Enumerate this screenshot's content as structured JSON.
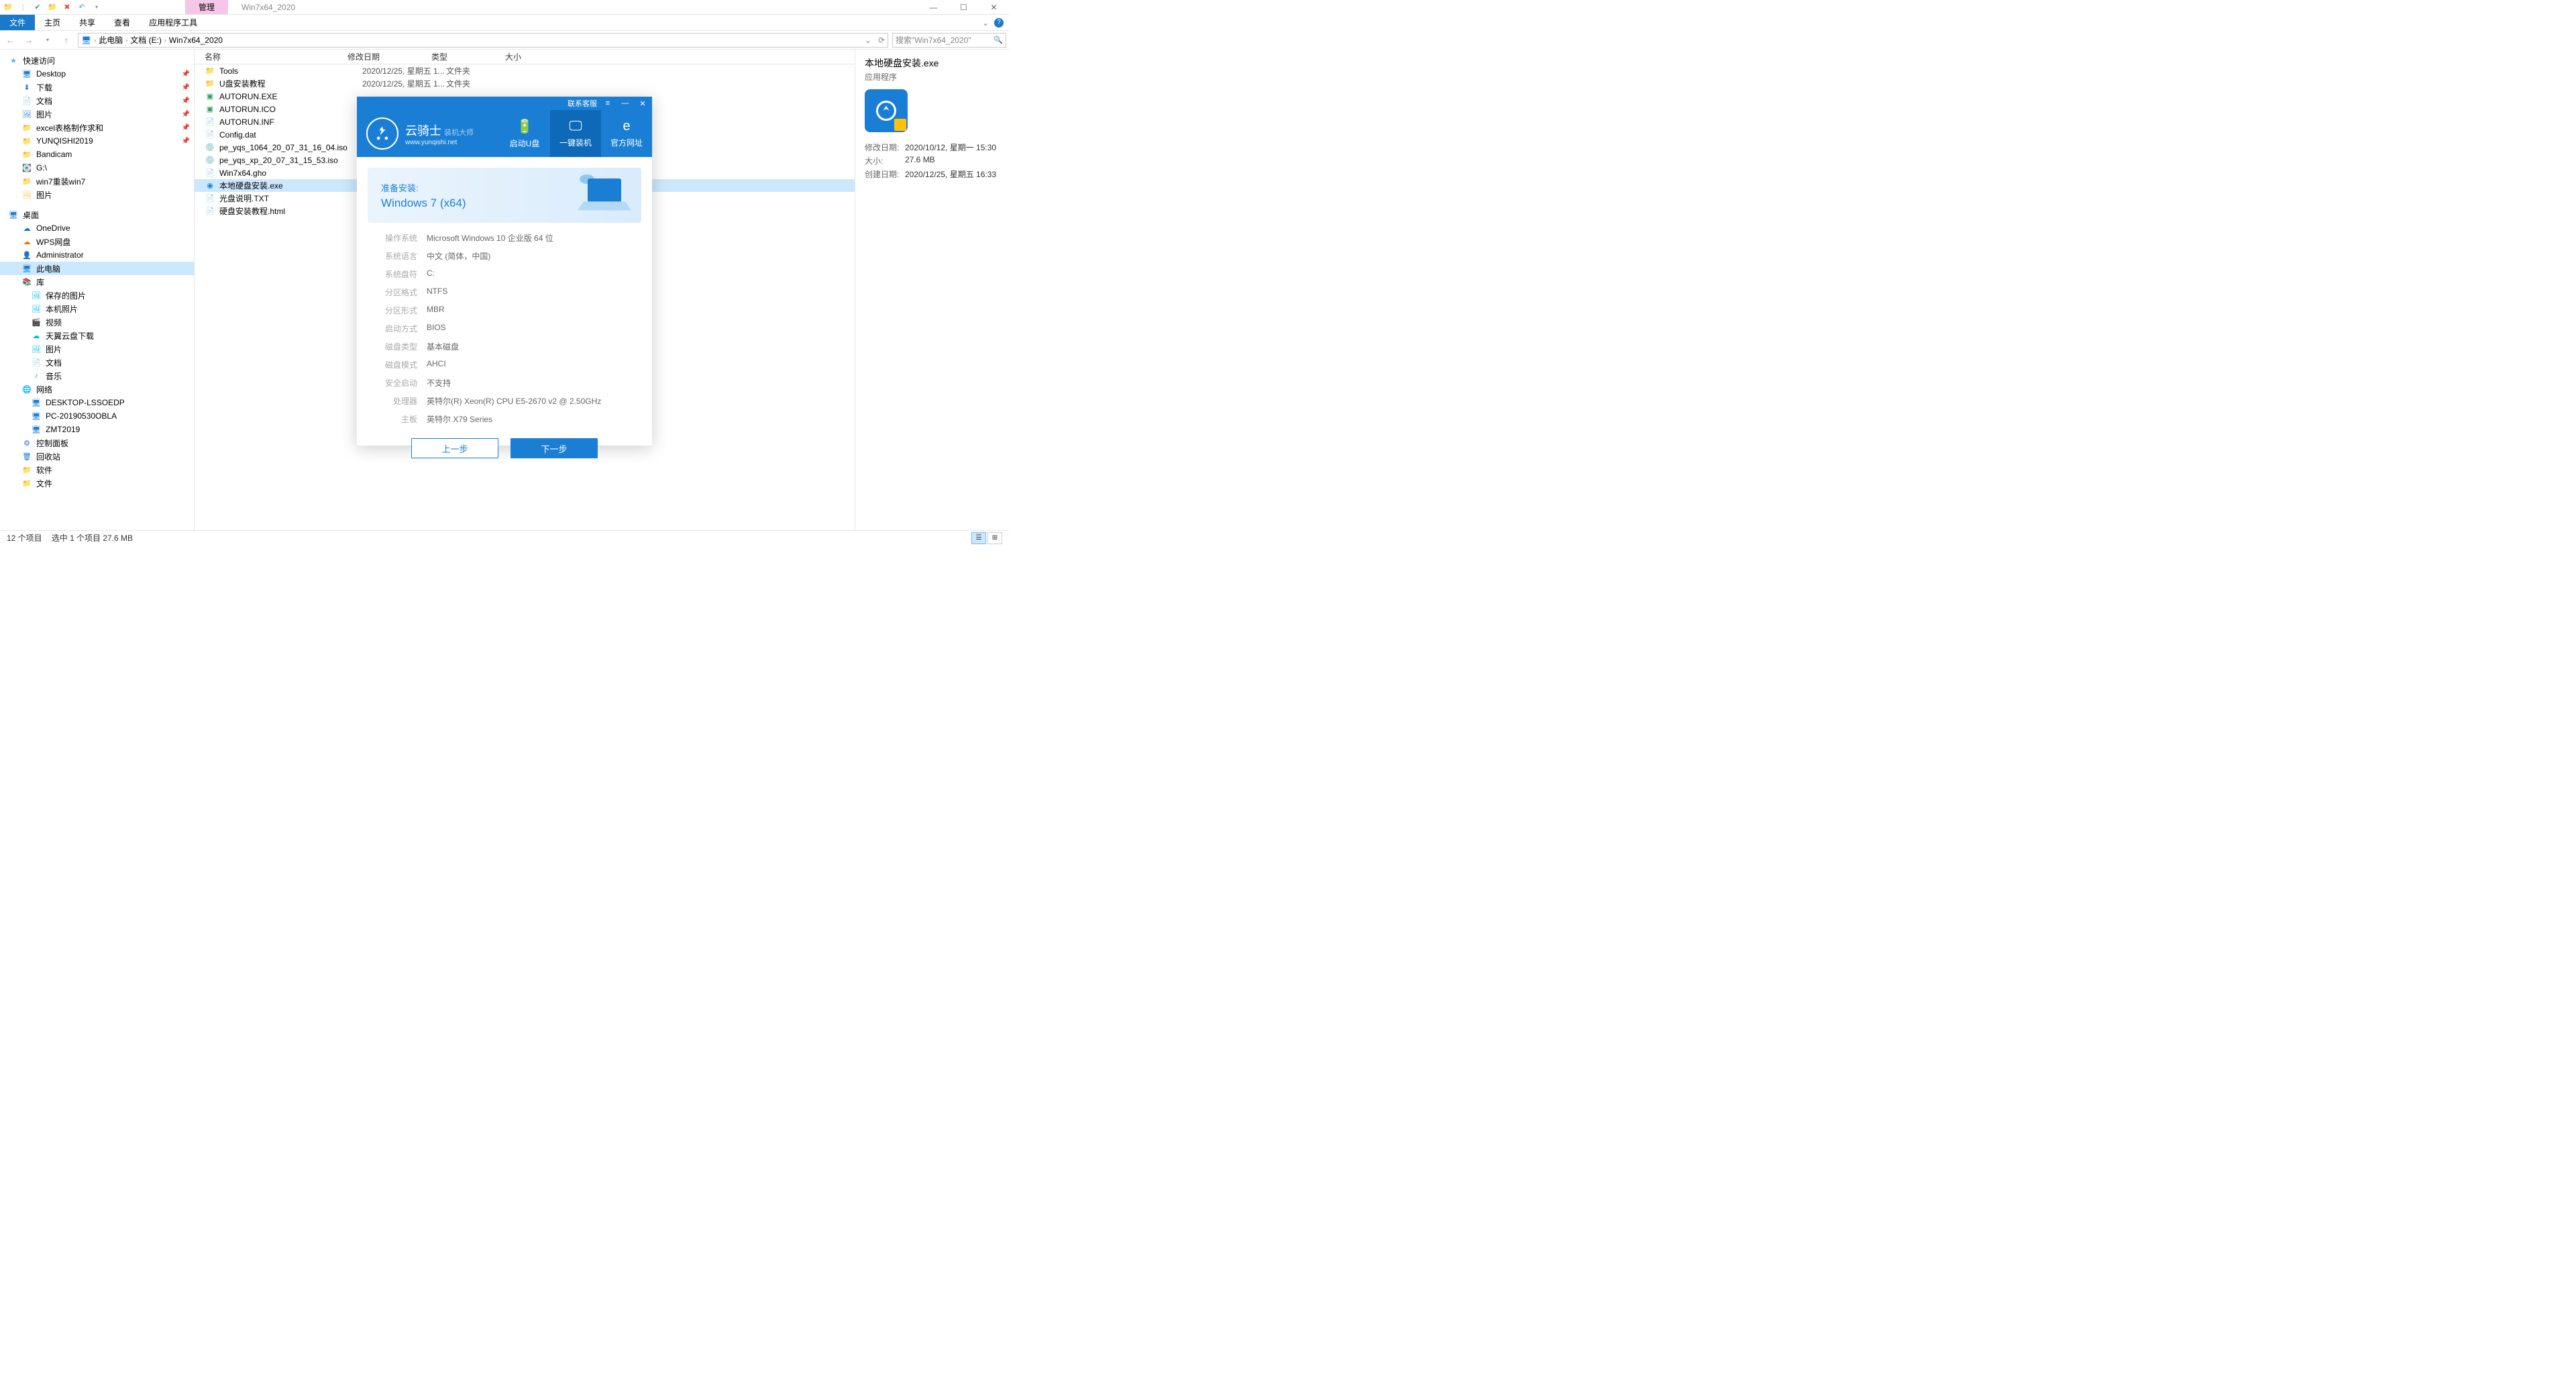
{
  "window": {
    "manage_tab": "管理",
    "title": "Win7x64_2020",
    "min": "—",
    "max": "☐",
    "close": "✕"
  },
  "ribbon": {
    "file": "文件",
    "tabs": [
      "主页",
      "共享",
      "查看",
      "应用程序工具"
    ],
    "chevron": "⌄",
    "help": "?"
  },
  "address": {
    "back": "←",
    "fwd": "→",
    "up": "↑",
    "crumbs": [
      "此电脑",
      "文档 (E:)",
      "Win7x64_2020"
    ],
    "refresh": "⟳",
    "search_placeholder": "搜索\"Win7x64_2020\"",
    "search_icon": "🔍"
  },
  "nav": {
    "quick": {
      "label": "快速访问",
      "items": [
        {
          "icon": "🖥",
          "label": "Desktop",
          "pin": true,
          "cls": "ico-blue"
        },
        {
          "icon": "⬇",
          "label": "下载",
          "pin": true,
          "cls": "ico-blue"
        },
        {
          "icon": "📄",
          "label": "文档",
          "pin": true,
          "cls": "ico-blue"
        },
        {
          "icon": "🖼",
          "label": "图片",
          "pin": true,
          "cls": "ico-blue"
        },
        {
          "icon": "📁",
          "label": "excel表格制作求和",
          "pin": true,
          "cls": "ico-folder"
        },
        {
          "icon": "📁",
          "label": "YUNQISHI2019",
          "pin": true,
          "cls": "ico-folder"
        },
        {
          "icon": "📁",
          "label": "Bandicam",
          "pin": false,
          "cls": "ico-folder"
        },
        {
          "icon": "💽",
          "label": "G:\\",
          "pin": false,
          "cls": "ico-disk"
        },
        {
          "icon": "📁",
          "label": "win7重装win7",
          "pin": false,
          "cls": "ico-folder"
        },
        {
          "icon": "🖼",
          "label": "图片",
          "pin": false,
          "cls": "ico-folder"
        }
      ]
    },
    "desktop": {
      "label": "桌面",
      "items": [
        {
          "icon": "☁",
          "label": "OneDrive",
          "cls": "ico-onedrive"
        },
        {
          "icon": "☁",
          "label": "WPS网盘",
          "cls": "ico-wps"
        },
        {
          "icon": "👤",
          "label": "Administrator",
          "cls": "ico-admin"
        },
        {
          "icon": "🖥",
          "label": "此电脑",
          "cls": "ico-blue",
          "selected": true
        },
        {
          "icon": "📚",
          "label": "库",
          "cls": "ico-folder"
        },
        {
          "icon": "🖼",
          "label": "保存的图片",
          "cls": "ico-cyan",
          "indent": true
        },
        {
          "icon": "🖼",
          "label": "本机照片",
          "cls": "ico-cyan",
          "indent": true
        },
        {
          "icon": "🎬",
          "label": "视频",
          "cls": "ico-cyan",
          "indent": true
        },
        {
          "icon": "☁",
          "label": "天翼云盘下载",
          "cls": "ico-cyan",
          "indent": true
        },
        {
          "icon": "🖼",
          "label": "图片",
          "cls": "ico-cyan",
          "indent": true
        },
        {
          "icon": "📄",
          "label": "文档",
          "cls": "ico-cyan",
          "indent": true
        },
        {
          "icon": "♪",
          "label": "音乐",
          "cls": "ico-cyan",
          "indent": true
        },
        {
          "icon": "🌐",
          "label": "网络",
          "cls": "ico-blue"
        },
        {
          "icon": "🖥",
          "label": "DESKTOP-LSSOEDP",
          "cls": "ico-blue",
          "indent": true
        },
        {
          "icon": "🖥",
          "label": "PC-20190530OBLA",
          "cls": "ico-blue",
          "indent": true
        },
        {
          "icon": "🖥",
          "label": "ZMT2019",
          "cls": "ico-blue",
          "indent": true
        },
        {
          "icon": "⚙",
          "label": "控制面板",
          "cls": "ico-blue"
        },
        {
          "icon": "🗑",
          "label": "回收站",
          "cls": "ico-blue"
        },
        {
          "icon": "📁",
          "label": "软件",
          "cls": "ico-folder"
        },
        {
          "icon": "📁",
          "label": "文件",
          "cls": "ico-folder"
        }
      ]
    }
  },
  "columns": {
    "name": "名称",
    "date": "修改日期",
    "type": "类型",
    "size": "大小"
  },
  "files": [
    {
      "icon": "📁",
      "name": "Tools",
      "date": "2020/12/25, 星期五 1...",
      "type": "文件夹",
      "cls": "ico-folder"
    },
    {
      "icon": "📁",
      "name": "U盘安装教程",
      "date": "2020/12/25, 星期五 1...",
      "type": "文件夹",
      "cls": "ico-folder"
    },
    {
      "icon": "▣",
      "name": "AUTORUN.EXE",
      "date": "",
      "type": "",
      "cls": "ico-green"
    },
    {
      "icon": "▣",
      "name": "AUTORUN.ICO",
      "date": "",
      "type": "",
      "cls": "ico-green"
    },
    {
      "icon": "📄",
      "name": "AUTORUN.INF",
      "date": "",
      "type": "",
      "cls": "ico-file"
    },
    {
      "icon": "📄",
      "name": "Config.dat",
      "date": "",
      "type": "",
      "cls": "ico-file"
    },
    {
      "icon": "💿",
      "name": "pe_yqs_1064_20_07_31_16_04.iso",
      "date": "",
      "type": "",
      "cls": "ico-disk"
    },
    {
      "icon": "💿",
      "name": "pe_yqs_xp_20_07_31_15_53.iso",
      "date": "",
      "type": "",
      "cls": "ico-disk"
    },
    {
      "icon": "📄",
      "name": "Win7x64.gho",
      "date": "",
      "type": "",
      "cls": "ico-file"
    },
    {
      "icon": "◉",
      "name": "本地硬盘安装.exe",
      "date": "",
      "type": "",
      "cls": "ico-blue",
      "selected": true
    },
    {
      "icon": "📄",
      "name": "光盘说明.TXT",
      "date": "",
      "type": "",
      "cls": "ico-file"
    },
    {
      "icon": "📄",
      "name": "硬盘安装教程.html",
      "date": "",
      "type": "",
      "cls": "ico-file"
    }
  ],
  "details": {
    "title": "本地硬盘安装.exe",
    "subtitle": "应用程序",
    "rows": [
      {
        "label": "修改日期:",
        "value": "2020/10/12, 星期一 15:30"
      },
      {
        "label": "大小:",
        "value": "27.6 MB"
      },
      {
        "label": "创建日期:",
        "value": "2020/12/25, 星期五 16:33"
      }
    ]
  },
  "status": {
    "items": "12 个项目",
    "selected": "选中 1 个项目  27.6 MB"
  },
  "dialog": {
    "contact": "联系客服",
    "menu": "≡",
    "min": "—",
    "close": "✕",
    "brand_main": "云骑士",
    "brand_sub": "装机大师",
    "brand_url": "www.yunqishi.net",
    "tabs": [
      {
        "icon": "🔋",
        "label": "启动U盘"
      },
      {
        "icon": "🖵",
        "label": "一键装机",
        "active": true
      },
      {
        "icon": "e",
        "label": "官方网址"
      }
    ],
    "prep": "准备安装:",
    "os": "Windows 7 (x64)",
    "info": [
      {
        "label": "操作系统",
        "value": "Microsoft Windows 10 企业版 64 位"
      },
      {
        "label": "系统语言",
        "value": "中文 (简体，中国)"
      },
      {
        "label": "系统盘符",
        "value": "C:"
      },
      {
        "label": "分区格式",
        "value": "NTFS"
      },
      {
        "label": "分区形式",
        "value": "MBR"
      },
      {
        "label": "启动方式",
        "value": "BIOS"
      },
      {
        "label": "磁盘类型",
        "value": "基本磁盘"
      },
      {
        "label": "磁盘模式",
        "value": "AHCI"
      },
      {
        "label": "安全启动",
        "value": "不支持"
      },
      {
        "label": "处理器",
        "value": "英特尔(R) Xeon(R) CPU E5-2670 v2 @ 2.50GHz"
      },
      {
        "label": "主板",
        "value": "英特尔 X79 Series"
      }
    ],
    "btn_prev": "上一步",
    "btn_next": "下一步"
  }
}
